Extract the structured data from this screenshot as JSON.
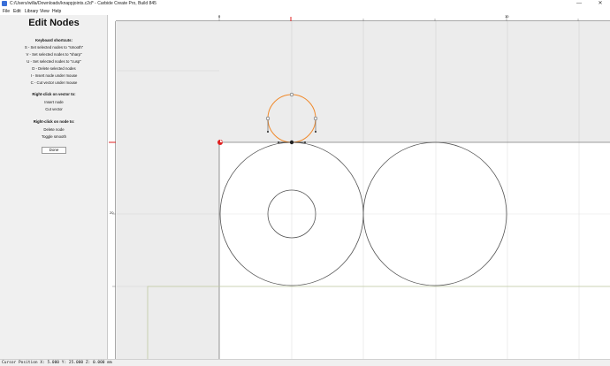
{
  "window": {
    "title": "C:/Users/willa/Downloads/knappjoints.c2d* - Carbide Create Pro, Build 845",
    "minimize_glyph": "—",
    "close_glyph": "✕"
  },
  "menu": {
    "items": [
      "File",
      "Edit",
      "Library",
      "View",
      "Help"
    ]
  },
  "panel": {
    "heading": "Edit Nodes",
    "shortcuts_title": "Keyboard shortcuts:",
    "shortcuts": [
      "S - Set selected nodes to \"smooth\"",
      "V - Set selected nodes to \"sharp\"",
      "U - Set selected nodes to \"cusp\"",
      "D - Delete selected nodes",
      "I - Insert node under mouse",
      "C - Cut vector under mouse"
    ],
    "vector_title": "Right-click on vector to:",
    "vector_actions": [
      "Insert node",
      "Cut vector"
    ],
    "node_title": "Right-click on node to:",
    "node_actions": [
      "Delete node",
      "Toggle smooth"
    ],
    "done_label": "Done"
  },
  "rulers": {
    "h_labels": [
      "0",
      "10"
    ],
    "v_labels": [
      "20"
    ]
  },
  "status": {
    "cursor_position": "Cursor Position X: 5.000 Y: 25.000 Z: 0.000 mm"
  },
  "colors": {
    "selected_vector": "#f08a2c",
    "vector": "#555555",
    "origin_marker": "#e02020",
    "stock_outline": "#bfc9a0"
  }
}
